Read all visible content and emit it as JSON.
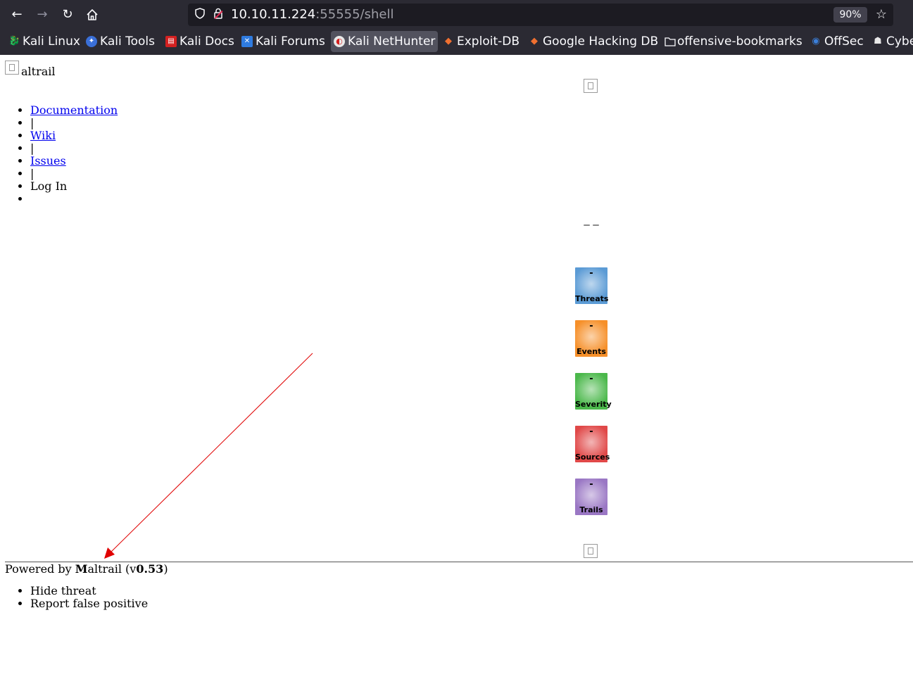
{
  "browser": {
    "url_host": "10.10.11.224",
    "url_path": ":55555/shell",
    "zoom": "90%",
    "bookmarks": [
      {
        "label": "Kali Linux",
        "icon": "kali-dragon-icon"
      },
      {
        "label": "Kali Tools",
        "icon": "kali-tools-icon"
      },
      {
        "label": "Kali Docs",
        "icon": "kali-docs-icon"
      },
      {
        "label": "Kali Forums",
        "icon": "kali-forums-icon"
      },
      {
        "label": "Kali NetHunter",
        "icon": "nethunter-icon"
      },
      {
        "label": "Exploit-DB",
        "icon": "exploit-db-icon"
      },
      {
        "label": "Google Hacking DB",
        "icon": "ghdb-icon"
      },
      {
        "label": "offensive-bookmarks",
        "icon": "folder-icon"
      },
      {
        "label": "OffSec",
        "icon": "offsec-icon"
      },
      {
        "label": "Cybe",
        "icon": "cyber-icon"
      }
    ]
  },
  "page": {
    "logo_text": "altrail",
    "menu": {
      "documentation": "Documentation",
      "sep": "|",
      "wiki": "Wiki",
      "issues": "Issues",
      "login": "Log In"
    },
    "stats": [
      {
        "label": "Threats",
        "value": "-",
        "color": "#5b9bd5"
      },
      {
        "label": "Events",
        "value": "-",
        "color": "#f6902a"
      },
      {
        "label": "Severity",
        "value": "-",
        "color": "#4bb84b"
      },
      {
        "label": "Sources",
        "value": "-",
        "color": "#e04848"
      },
      {
        "label": "Trails",
        "value": "-",
        "color": "#9a77c4"
      }
    ],
    "footer": {
      "prefix": "Powered by ",
      "brand_m": "M",
      "brand_rest": "altrail",
      "version_open": " (v",
      "version": "0.53",
      "version_close": ")"
    },
    "context_menu": {
      "hide_threat": "Hide threat",
      "report_false_positive": "Report false positive"
    },
    "annotation_color": "#e00000"
  }
}
